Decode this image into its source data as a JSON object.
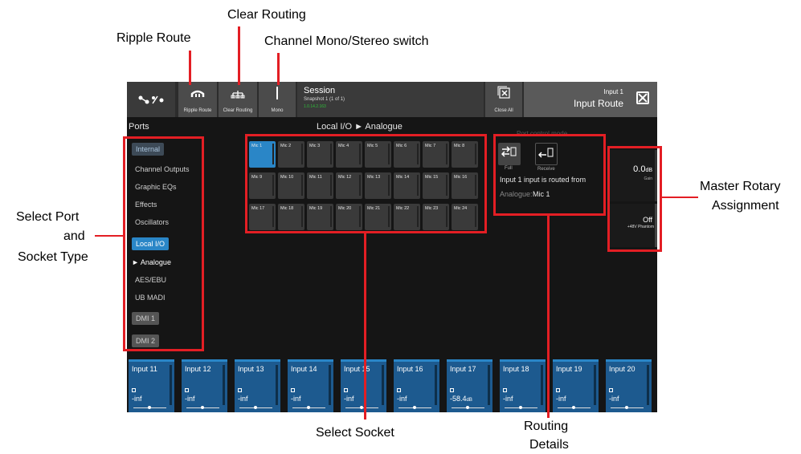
{
  "annotations": {
    "clear_routing": "Clear Routing",
    "ripple_route": "Ripple Route",
    "mono_stereo": "Channel Mono/Stereo switch",
    "master_rotary_1": "Master Rotary",
    "master_rotary_2": "Assignment",
    "select_port_1": "Select Port",
    "select_port_2": "and",
    "select_port_3": "Socket Type",
    "select_socket": "Select Socket",
    "routing_details_1": "Routing",
    "routing_details_2": "Details"
  },
  "toolbar": {
    "ripple_route": "Ripple Route",
    "clear_routing": "Clear Routing",
    "mono": "Mono",
    "session_title": "Session",
    "session_snapshot": "Snapshot 1 (1 of 1)",
    "session_code": "1.0.14.2.163",
    "close_all": "Close All",
    "input_name": "Input 1",
    "input_route": "Input Route"
  },
  "ports": {
    "header": "Ports",
    "internal": "Internal",
    "internal_items": [
      "Channel Outputs",
      "Graphic EQs",
      "Effects",
      "Oscillators"
    ],
    "local_io": "Local I/O",
    "analogue": "► Analogue",
    "aes": "AES/EBU",
    "ub_madi": "UB MADI",
    "dmi1": "DMI 1",
    "dmi2": "DMI 2"
  },
  "sockets": {
    "header": "Local I/O ► Analogue",
    "items": [
      "Mic 1",
      "Mic 2",
      "Mic 3",
      "Mic 4",
      "Mic 5",
      "Mic 6",
      "Mic 7",
      "Mic 8",
      "Mic 9",
      "Mic 10",
      "Mic 11",
      "Mic 12",
      "Mic 13",
      "Mic 14",
      "Mic 15",
      "Mic 16",
      "Mic 17",
      "Mic 18",
      "Mic 19",
      "Mic 20",
      "Mic 21",
      "Mic 22",
      "Mic 23",
      "Mic 24"
    ],
    "selected": "Mic 1"
  },
  "port_control": {
    "header": "Port control mode",
    "full": "Full",
    "receive": "Receive",
    "routed_text": "Input 1 input is routed from",
    "source_label": "Analogue:",
    "source_value": "Mic 1"
  },
  "rotary": {
    "gain_value": "0.0",
    "gain_unit": "dB",
    "gain_label": "Gain",
    "phantom_value": "Off",
    "phantom_label": "+48V Phantom"
  },
  "channels": [
    {
      "name": "Input 11",
      "value": "-inf",
      "unit": ""
    },
    {
      "name": "Input 12",
      "value": "-inf",
      "unit": ""
    },
    {
      "name": "Input 13",
      "value": "-inf",
      "unit": ""
    },
    {
      "name": "Input 14",
      "value": "-inf",
      "unit": ""
    },
    {
      "name": "Input 15",
      "value": "-inf",
      "unit": ""
    },
    {
      "name": "Input 16",
      "value": "-inf",
      "unit": ""
    },
    {
      "name": "Input 17",
      "value": "-58.4",
      "unit": "dB"
    },
    {
      "name": "Input 18",
      "value": "-inf",
      "unit": ""
    },
    {
      "name": "Input 19",
      "value": "-inf",
      "unit": ""
    },
    {
      "name": "Input 20",
      "value": "-inf",
      "unit": ""
    }
  ],
  "colors": {
    "accent": "#2a86c7",
    "annotation": "#e31e24",
    "channel": "#1d5a8f"
  }
}
